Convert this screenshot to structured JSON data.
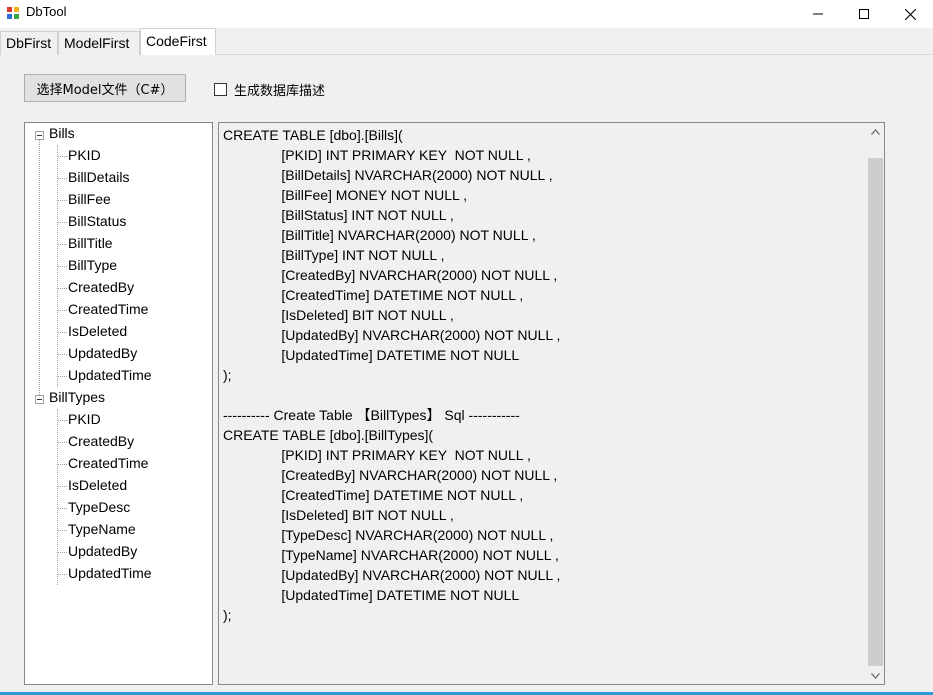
{
  "window": {
    "title": "DbTool",
    "accent": "#2a9bd6"
  },
  "tabs": [
    {
      "label": "DbFirst"
    },
    {
      "label": "ModelFirst"
    },
    {
      "label": "CodeFirst",
      "selected": true
    }
  ],
  "toolbar": {
    "select_model_label": "选择Model文件（C#）",
    "gen_desc_label": "生成数据库描述",
    "gen_desc_checked": false
  },
  "tree": {
    "nodes": [
      {
        "label": "Bills",
        "children": [
          "PKID",
          "BillDetails",
          "BillFee",
          "BillStatus",
          "BillTitle",
          "BillType",
          "CreatedBy",
          "CreatedTime",
          "IsDeleted",
          "UpdatedBy",
          "UpdatedTime"
        ]
      },
      {
        "label": "BillTypes",
        "children": [
          "PKID",
          "CreatedBy",
          "CreatedTime",
          "IsDeleted",
          "TypeDesc",
          "TypeName",
          "UpdatedBy",
          "UpdatedTime"
        ]
      }
    ]
  },
  "sql_output": [
    "CREATE TABLE [dbo].[Bills](",
    "               [PKID] INT PRIMARY KEY  NOT NULL ,",
    "               [BillDetails] NVARCHAR(2000) NOT NULL ,",
    "               [BillFee] MONEY NOT NULL ,",
    "               [BillStatus] INT NOT NULL ,",
    "               [BillTitle] NVARCHAR(2000) NOT NULL ,",
    "               [BillType] INT NOT NULL ,",
    "               [CreatedBy] NVARCHAR(2000) NOT NULL ,",
    "               [CreatedTime] DATETIME NOT NULL ,",
    "               [IsDeleted] BIT NOT NULL ,",
    "               [UpdatedBy] NVARCHAR(2000) NOT NULL ,",
    "               [UpdatedTime] DATETIME NOT NULL",
    ");",
    "",
    "---------- Create Table 【BillTypes】 Sql -----------",
    "CREATE TABLE [dbo].[BillTypes](",
    "               [PKID] INT PRIMARY KEY  NOT NULL ,",
    "               [CreatedBy] NVARCHAR(2000) NOT NULL ,",
    "               [CreatedTime] DATETIME NOT NULL ,",
    "               [IsDeleted] BIT NOT NULL ,",
    "               [TypeDesc] NVARCHAR(2000) NOT NULL ,",
    "               [TypeName] NVARCHAR(2000) NOT NULL ,",
    "               [UpdatedBy] NVARCHAR(2000) NOT NULL ,",
    "               [UpdatedTime] DATETIME NOT NULL",
    ");"
  ],
  "icons": {
    "app": "app-icon",
    "minimize": "minimize-icon",
    "maximize": "maximize-icon",
    "close": "close-icon",
    "scroll_up": "chevron-up-icon",
    "scroll_down": "chevron-down-icon",
    "tree_toggle": "collapse-icon"
  }
}
